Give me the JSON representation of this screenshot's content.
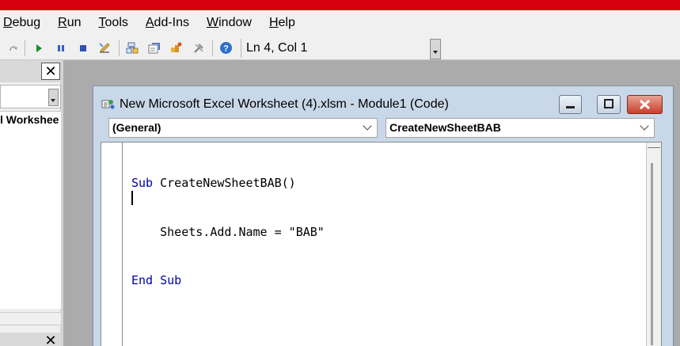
{
  "menu": {
    "items": [
      "Debug",
      "Run",
      "Tools",
      "Add-Ins",
      "Window",
      "Help"
    ],
    "underline": [
      "D",
      "R",
      "T",
      "A",
      "W",
      "H"
    ]
  },
  "toolbar": {
    "status": "Ln 4, Col 1",
    "icons": [
      "redo-icon",
      "run-icon",
      "break-icon",
      "reset-icon",
      "design-mode-icon",
      "project-explorer-icon",
      "properties-window-icon",
      "object-browser-icon",
      "toolbox-icon",
      "help-icon"
    ]
  },
  "left_panel": {
    "close_label": "✕",
    "tree_item": "l Workshee",
    "close_label_2": "✕"
  },
  "code_window": {
    "title": "New Microsoft Excel Worksheet (4).xlsm - Module1 (Code)",
    "object_combo": "(General)",
    "procedure_combo": "CreateNewSheetBAB",
    "lines": [
      {
        "keyword": "Sub",
        "rest": " CreateNewSheetBAB()"
      },
      {
        "keyword": "",
        "rest": "    Sheets.Add.Name = \"BAB\""
      },
      {
        "keyword": "End Sub",
        "rest": ""
      }
    ]
  },
  "colors": {
    "accent_red": "#d6000d",
    "keyword_blue": "#0000a8",
    "close_button": "#c9402b"
  }
}
